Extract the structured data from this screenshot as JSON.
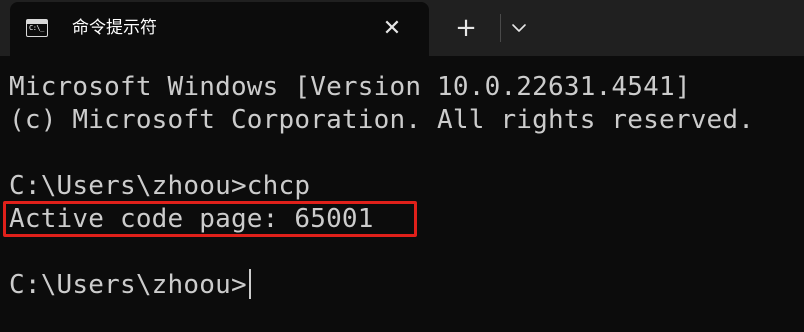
{
  "window": {
    "tab": {
      "icon": "cmd-terminal-icon",
      "icon_prompt": "C:\\_",
      "title": "命令提示符",
      "close_glyph": "✕"
    },
    "new_tab_glyph": "+",
    "dropdown_icon": "chevron-down-icon"
  },
  "terminal": {
    "lines": [
      "Microsoft Windows [Version 10.0.22631.4541]",
      "(c) Microsoft Corporation. All rights reserved.",
      "",
      "C:\\Users\\zhoou>chcp",
      "Active code page: 65001",
      "",
      "C:\\Users\\zhoou>"
    ],
    "highlighted_line": "Active code page: 65001",
    "highlight_color": "#e0201a",
    "text_color": "#cccccc",
    "background_color": "#0c0c0c"
  }
}
